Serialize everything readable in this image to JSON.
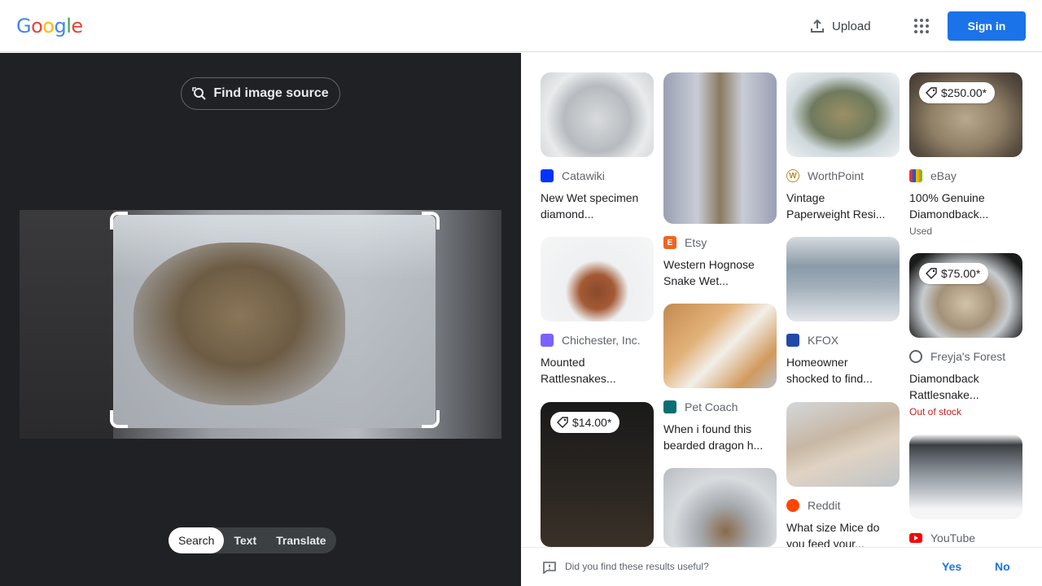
{
  "header": {
    "logo_letters": [
      "G",
      "o",
      "o",
      "g",
      "l",
      "e"
    ],
    "upload_label": "Upload",
    "apps_icon": "apps-grid-icon",
    "signin_label": "Sign in"
  },
  "left": {
    "find_source_label": "Find image source",
    "tabs": [
      {
        "label": "Search",
        "active": true
      },
      {
        "label": "Text",
        "active": false
      },
      {
        "label": "Translate",
        "active": false
      }
    ]
  },
  "results": {
    "cards": [
      {
        "source": "Catawiki",
        "title_line1": "New Wet specimen",
        "title_line2": "diamond...",
        "price": "",
        "status": "",
        "favicon_color": "#0033ff"
      },
      {
        "source": "Etsy",
        "title_line1": "Western Hognose",
        "title_line2": "Snake Wet...",
        "price": "",
        "status": "",
        "favicon_color": "#f1641e"
      },
      {
        "source": "WorthPoint",
        "title_line1": "Vintage",
        "title_line2": "Paperweight Resi...",
        "price": "",
        "status": "",
        "favicon_color": "#b98c2d"
      },
      {
        "source": "eBay",
        "title_line1": "100% Genuine",
        "title_line2": "Diamondback...",
        "price": "$250.00*",
        "status": "Used",
        "favicon_color": "#e53238"
      },
      {
        "source": "Chichester, Inc.",
        "title_line1": "Mounted",
        "title_line2": "Rattlesnakes...",
        "price": "",
        "status": "",
        "favicon_color": "#7b61ff"
      },
      {
        "source": "Pet Coach",
        "title_line1": "When i found this",
        "title_line2": "bearded dragon h...",
        "price": "",
        "status": "",
        "favicon_color": "#0b6e75"
      },
      {
        "source": "KFOX",
        "title_line1": "Homeowner",
        "title_line2": "shocked to find...",
        "price": "",
        "status": "",
        "favicon_color": "#1f4aa8"
      },
      {
        "source": "Freyja's Forest",
        "title_line1": "Diamondback",
        "title_line2": "Rattlesnake...",
        "price": "$75.00*",
        "status": "Out of stock",
        "favicon_color": "#5f6368"
      },
      {
        "source": "",
        "title_line1": "",
        "title_line2": "",
        "price": "$14.00*",
        "status": "",
        "favicon_color": ""
      },
      {
        "source": "Reddit",
        "title_line1": "What size Mice do",
        "title_line2": "you feed your...",
        "price": "",
        "status": "",
        "favicon_color": "#ff4500"
      },
      {
        "source": "YouTube",
        "title_line1": "",
        "title_line2": "",
        "price": "",
        "status": "",
        "favicon_color": "#ff0000"
      }
    ]
  },
  "feedback": {
    "question": "Did you find these results useful?",
    "yes_label": "Yes",
    "no_label": "No"
  }
}
